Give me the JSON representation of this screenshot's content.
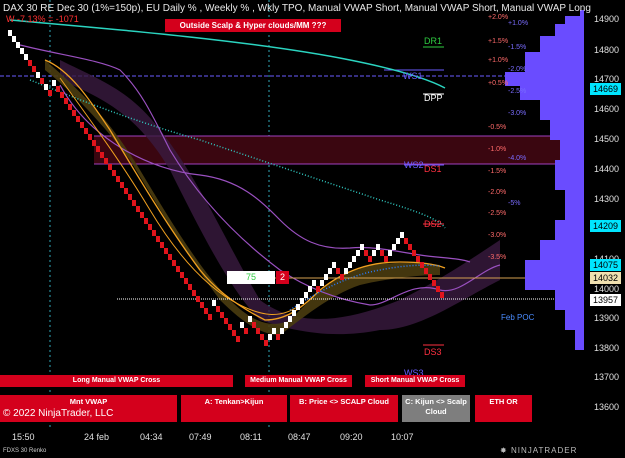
{
  "header": {
    "title": "DAX 30 RE Dec 30 (1%=150p), EU Daily % , Weekly % , Wkly TPO, Manual VWAP Short, Manual VWAP Short, Manual VWAP Long",
    "sub": "W -7.13% = -1071",
    "banner": "Outside Scalp & Hyper clouds/MM ???"
  },
  "levels": {
    "dr1": "DR1",
    "ws1": "WS1",
    "dpp": "DPP",
    "ws2": "WS2",
    "ds1": "DS1",
    "ds2": "DS2",
    "ds3": "DS3",
    "ws3": "WS3",
    "feb_poc": "Feb POC"
  },
  "colors": {
    "bg": "#000000",
    "bull": "#ffffff",
    "bear": "#e0141c",
    "accent_red": "#d4001c",
    "volume_profile": "#6a4cff",
    "price_tag": "#00e5ff"
  },
  "pct_left": [
    "+2.0%",
    "+1.5%",
    "+1.0%",
    "+0.5%",
    "-0.5%",
    "-1.0%",
    "-1.5%",
    "-2.0%",
    "-2.5%",
    "-3.0%",
    "-3.5%"
  ],
  "pct_right": [
    "+1.0%",
    "-1.5%",
    "-2.0%",
    "-2.5%",
    "-3.0%",
    "-4.0%",
    "-5%"
  ],
  "price_axis": [
    "14900",
    "14800",
    "14700",
    "14600",
    "14500",
    "14400",
    "14300",
    "14200",
    "14100",
    "14000",
    "13900",
    "13800",
    "13700",
    "13600"
  ],
  "price_tags": {
    "top": "14669",
    "mid": "14209",
    "cur1": "14075",
    "cur2": "14032",
    "low": "13957"
  },
  "position": {
    "qty": "75",
    "side": "2"
  },
  "x_axis": [
    "15:50",
    "24 feb",
    "04:34",
    "07:49",
    "08:11",
    "08:47",
    "09:20",
    "10:07"
  ],
  "buttons_row1": {
    "long": "Long Manual VWAP Cross",
    "medium": "Medium Manual VWAP Cross",
    "short": "Short Manual VWAP Cross"
  },
  "buttons_row2": {
    "mnt": "Mnt VWAP",
    "tenkan": "A: Tenkan>Kijun",
    "price": "B: Price <> SCALP Cloud",
    "kijun": "C: Kijun <> Scalp Cloud",
    "eth": "ETH OR"
  },
  "footer": {
    "copyright": "© 2022 NinjaTrader, LLC",
    "instrument": "FDXS 30 Renko",
    "brand": "NINJATRADER"
  }
}
